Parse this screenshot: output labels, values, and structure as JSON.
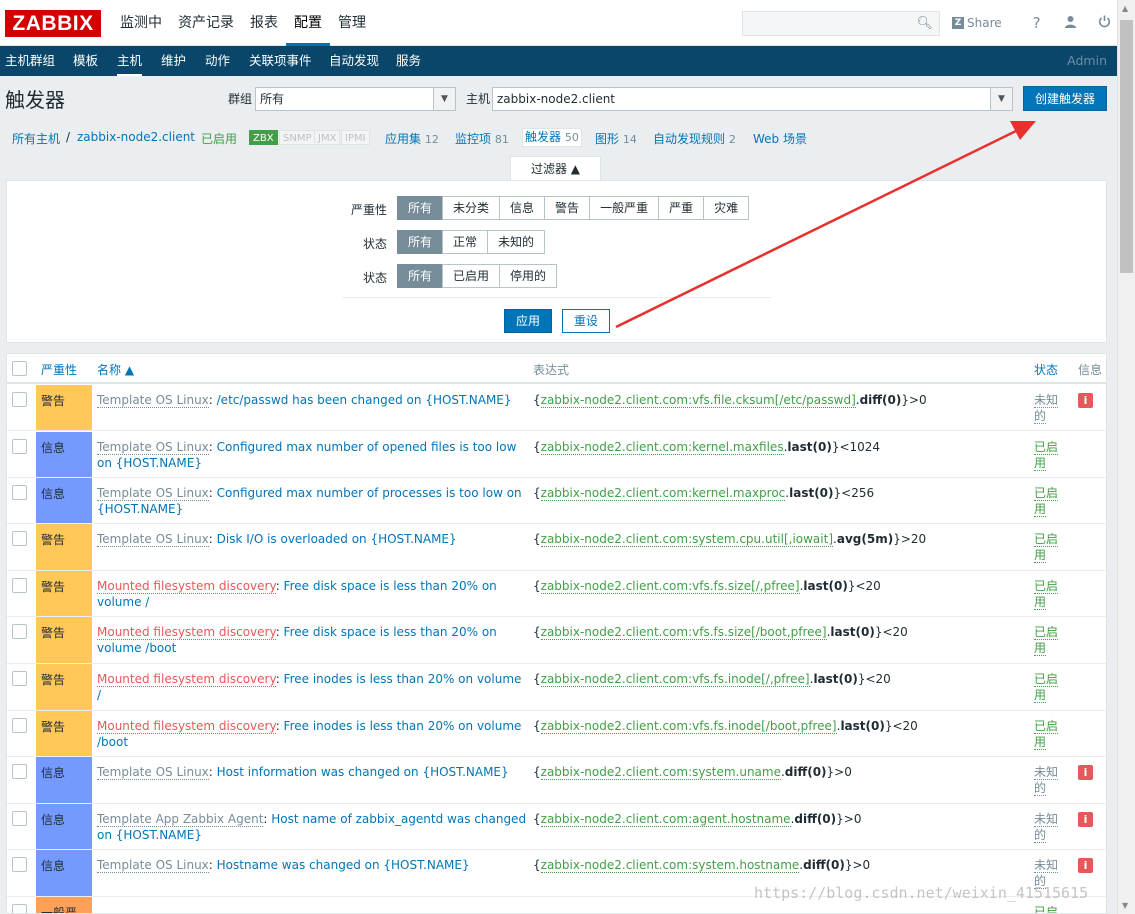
{
  "logo": "ZABBIX",
  "main_menu": [
    {
      "label": "监测中",
      "active": false
    },
    {
      "label": "资产记录",
      "active": false
    },
    {
      "label": "报表",
      "active": false
    },
    {
      "label": "配置",
      "active": true
    },
    {
      "label": "管理",
      "active": false
    }
  ],
  "search": {
    "placeholder": ""
  },
  "top_icons": {
    "share_label": "Share",
    "help": "?",
    "user": "user-icon",
    "logout": "power-icon"
  },
  "sub_menu": [
    {
      "label": "主机群组",
      "active": false
    },
    {
      "label": "模板",
      "active": false
    },
    {
      "label": "主机",
      "active": true
    },
    {
      "label": "维护",
      "active": false
    },
    {
      "label": "动作",
      "active": false
    },
    {
      "label": "关联项事件",
      "active": false
    },
    {
      "label": "自动发现",
      "active": false
    },
    {
      "label": "服务",
      "active": false
    }
  ],
  "user": "Admin",
  "page": {
    "title": "触发器",
    "group_label": "群组",
    "group_value": "所有",
    "host_label": "主机",
    "host_value": "zabbix-node2.client",
    "create_button": "创建触发器"
  },
  "host_nav": {
    "all_hosts": "所有主机",
    "separator": "/",
    "host": "zabbix-node2.client",
    "status": "已启用",
    "badges": [
      {
        "label": "ZBX",
        "on": true
      },
      {
        "label": "SNMP",
        "on": false
      },
      {
        "label": "JMX",
        "on": false
      },
      {
        "label": "IPMI",
        "on": false
      }
    ],
    "links": [
      {
        "label": "应用集",
        "count": "12"
      },
      {
        "label": "监控项",
        "count": "81"
      },
      {
        "label": "触发器",
        "count": "50"
      },
      {
        "label": "图形",
        "count": "14"
      },
      {
        "label": "自动发现规则",
        "count": "2"
      },
      {
        "label": "Web 场景",
        "count": ""
      }
    ]
  },
  "filter": {
    "tab_label": "过滤器 ▲",
    "rows": [
      {
        "label": "严重性",
        "options": [
          "所有",
          "未分类",
          "信息",
          "警告",
          "一般严重",
          "严重",
          "灾难"
        ],
        "selected": 0
      },
      {
        "label": "状态",
        "options": [
          "所有",
          "正常",
          "未知的"
        ],
        "selected": 0
      },
      {
        "label": "状态",
        "options": [
          "所有",
          "已启用",
          "停用的"
        ],
        "selected": 0
      }
    ],
    "apply": "应用",
    "reset": "重设"
  },
  "table": {
    "headers": {
      "severity": "严重性",
      "name": "名称 ▲",
      "expression": "表达式",
      "status": "状态",
      "info": "信息"
    },
    "rows": [
      {
        "severity": "警告",
        "sev": "warn",
        "template": "Template OS Linux",
        "discovery": false,
        "name": "/etc/passwd has been changed on {HOST.NAME}",
        "expr_open": "{",
        "expr_key": "zabbix-node2.client.com:vfs.file.cksum[/etc/passwd]",
        "expr_fn": "diff(0)",
        "expr_tail": "}>0",
        "status": "未知的",
        "status_class": "unknown",
        "info": true
      },
      {
        "severity": "信息",
        "sev": "info",
        "template": "Template OS Linux",
        "discovery": false,
        "name": "Configured max number of opened files is too low on {HOST.NAME}",
        "expr_open": "{",
        "expr_key": "zabbix-node2.client.com:kernel.maxfiles",
        "expr_fn": "last(0)",
        "expr_tail": "}<1024",
        "status": "已启用",
        "status_class": "enabled",
        "info": false
      },
      {
        "severity": "信息",
        "sev": "info",
        "template": "Template OS Linux",
        "discovery": false,
        "name": "Configured max number of processes is too low on {HOST.NAME}",
        "expr_open": "{",
        "expr_key": "zabbix-node2.client.com:kernel.maxproc",
        "expr_fn": "last(0)",
        "expr_tail": "}<256",
        "status": "已启用",
        "status_class": "enabled",
        "info": false
      },
      {
        "severity": "警告",
        "sev": "warn",
        "template": "Template OS Linux",
        "discovery": false,
        "name": "Disk I/O is overloaded on {HOST.NAME}",
        "expr_open": "{",
        "expr_key": "zabbix-node2.client.com:system.cpu.util[,iowait]",
        "expr_fn": "avg(5m)",
        "expr_tail": "}>20",
        "status": "已启用",
        "status_class": "enabled",
        "info": false
      },
      {
        "severity": "警告",
        "sev": "warn",
        "template": "Mounted filesystem discovery",
        "discovery": true,
        "name": "Free disk space is less than 20% on volume /",
        "expr_open": "{",
        "expr_key": "zabbix-node2.client.com:vfs.fs.size[/,pfree]",
        "expr_fn": "last(0)",
        "expr_tail": "}<20",
        "status": "已启用",
        "status_class": "enabled",
        "info": false
      },
      {
        "severity": "警告",
        "sev": "warn",
        "template": "Mounted filesystem discovery",
        "discovery": true,
        "name": "Free disk space is less than 20% on volume /boot",
        "expr_open": "{",
        "expr_key": "zabbix-node2.client.com:vfs.fs.size[/boot,pfree]",
        "expr_fn": "last(0)",
        "expr_tail": "}<20",
        "status": "已启用",
        "status_class": "enabled",
        "info": false
      },
      {
        "severity": "警告",
        "sev": "warn",
        "template": "Mounted filesystem discovery",
        "discovery": true,
        "name": "Free inodes is less than 20% on volume /",
        "expr_open": "{",
        "expr_key": "zabbix-node2.client.com:vfs.fs.inode[/,pfree]",
        "expr_fn": "last(0)",
        "expr_tail": "}<20",
        "status": "已启用",
        "status_class": "enabled",
        "info": false
      },
      {
        "severity": "警告",
        "sev": "warn",
        "template": "Mounted filesystem discovery",
        "discovery": true,
        "name": "Free inodes is less than 20% on volume /boot",
        "expr_open": "{",
        "expr_key": "zabbix-node2.client.com:vfs.fs.inode[/boot,pfree]",
        "expr_fn": "last(0)",
        "expr_tail": "}<20",
        "status": "已启用",
        "status_class": "enabled",
        "info": false
      },
      {
        "severity": "信息",
        "sev": "info",
        "template": "Template OS Linux",
        "discovery": false,
        "name": "Host information was changed on {HOST.NAME}",
        "expr_open": "{",
        "expr_key": "zabbix-node2.client.com:system.uname",
        "expr_fn": "diff(0)",
        "expr_tail": "}>0",
        "status": "未知的",
        "status_class": "unknown",
        "info": true
      },
      {
        "severity": "信息",
        "sev": "info",
        "template": "Template App Zabbix Agent",
        "discovery": false,
        "name": "Host name of zabbix_agentd was changed on {HOST.NAME}",
        "expr_open": "{",
        "expr_key": "zabbix-node2.client.com:agent.hostname",
        "expr_fn": "diff(0)",
        "expr_tail": "}>0",
        "status": "未知的",
        "status_class": "unknown",
        "info": true
      },
      {
        "severity": "信息",
        "sev": "info",
        "template": "Template OS Linux",
        "discovery": false,
        "name": "Hostname was changed on {HOST.NAME}",
        "expr_open": "{",
        "expr_key": "zabbix-node2.client.com:system.hostname",
        "expr_fn": "diff(0)",
        "expr_tail": "}>0",
        "status": "未知的",
        "status_class": "unknown",
        "info": true
      },
      {
        "severity": "一般严重",
        "sev": "avg",
        "template": "",
        "discovery": false,
        "name": "",
        "expr_open": "",
        "expr_key": "",
        "expr_fn": "",
        "expr_tail": "",
        "status": "已启用",
        "status_class": "enabled",
        "info": false
      }
    ],
    "info_symbol": "i"
  },
  "watermark": "https://blog.csdn.net/weixin_41515615"
}
